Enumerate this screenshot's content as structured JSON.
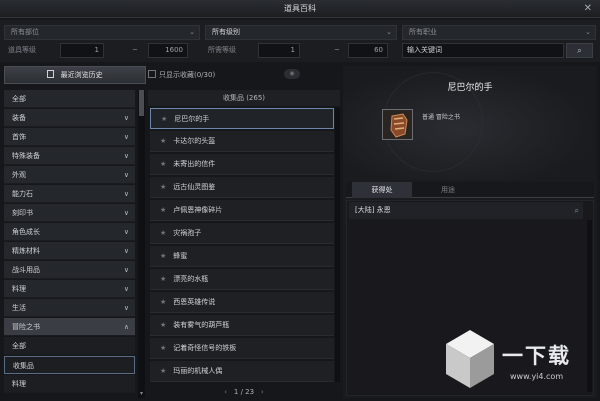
{
  "window": {
    "title": "道具百科",
    "close_glyph": "✕"
  },
  "filters": {
    "part_select": "所有部位",
    "grade_select": "所有级别",
    "class_select": "所有职业",
    "item_level_label": "道具等级",
    "item_level_min": "1",
    "item_level_max": "1600",
    "req_level_label": "所需等级",
    "req_level_min": "1",
    "req_level_max": "60",
    "range_sep": "~",
    "keyword_placeholder": "输入关键词",
    "chevron_glyph": "⌄",
    "search_glyph": "⌕"
  },
  "sidebar": {
    "history_button": "最近浏览历史",
    "items": [
      {
        "label": "全部",
        "chev": ""
      },
      {
        "label": "装备",
        "chev": "∨"
      },
      {
        "label": "首饰",
        "chev": "∨"
      },
      {
        "label": "特殊装备",
        "chev": "∨"
      },
      {
        "label": "外观",
        "chev": "∨"
      },
      {
        "label": "能力石",
        "chev": "∨"
      },
      {
        "label": "刻印书",
        "chev": "∨"
      },
      {
        "label": "角色成长",
        "chev": "∨"
      },
      {
        "label": "精炼材料",
        "chev": "∨"
      },
      {
        "label": "战斗用品",
        "chev": "∨"
      },
      {
        "label": "料理",
        "chev": "∨"
      },
      {
        "label": "生活",
        "chev": "∨"
      },
      {
        "label": "冒险之书",
        "chev": "∧"
      },
      {
        "label": "全部",
        "chev": ""
      },
      {
        "label": "收集品",
        "chev": ""
      },
      {
        "label": "料理",
        "chev": ""
      }
    ]
  },
  "list": {
    "favorites_only_label": "只显示收藏(0/30)",
    "header": "收集品 (265)",
    "star_glyph": "★",
    "items": [
      "尼巴尔的手",
      "卡达尔的头盔",
      "未寄出的信件",
      "远古仙灵图鉴",
      "卢佩恩神像碎片",
      "灾祸孢子",
      "蜂蜜",
      "漂亮的水瓶",
      "西恩英雄传说",
      "装有雾气的葫芦瓶",
      "记着奇怪信号的铁板",
      "玛丽的机械人偶"
    ],
    "pager": "1 / 23",
    "prev_glyph": "‹",
    "next_glyph": "›"
  },
  "detail": {
    "name": "尼巴尔的手",
    "type": "普通 冒险之书",
    "tab_source": "获得处",
    "tab_use": "用途",
    "source_entry": "[大陆] 永恩"
  },
  "watermark": {
    "brand": "一下载",
    "url": "www.yi4.com"
  },
  "colors": {
    "selection_border": "#6d85a8",
    "panel_bg": "#1a1b1f",
    "accent_text": "#eceef1"
  }
}
